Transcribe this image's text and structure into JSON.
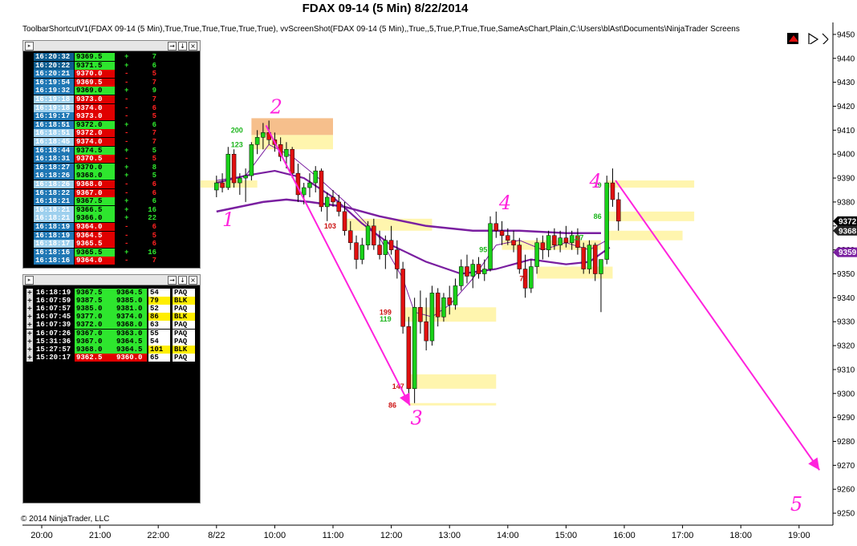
{
  "window": {
    "title": "FDAX 09-14 (5 Min)  8/22/2014",
    "indicator_line": "ToolbarShortcutV1(FDAX 09-14 (5 Min),True,True,True,True,True,True), vvScreenShot(FDAX 09-14 (5 Min),,True,,5,True,P,True,True,SameAsChart,Plain,C:\\Users\\blAst\\Documents\\NinjaTrader Screens",
    "copyright": "© 2014 NinjaTrader, LLC"
  },
  "colors": {
    "up_candle": "#19d119",
    "down_candle": "#e01010",
    "ma_color": "#7a1fa0",
    "zone_yellow": "#fff3a0",
    "zone_orange": "#f5b478",
    "annotation_magenta": "#ff22dd",
    "buy_green": "#33ff33",
    "sell_red": "#ff2222"
  },
  "chart_data": {
    "type": "candlestick",
    "title": "FDAX 09-14 (5 Min)  8/22/2014",
    "ylim": [
      9245,
      9455
    ],
    "y_ticks": [
      9250,
      9260,
      9270,
      9280,
      9290,
      9300,
      9310,
      9320,
      9330,
      9340,
      9350,
      9360,
      9370,
      9380,
      9390,
      9400,
      9410,
      9420,
      9430,
      9440,
      9450
    ],
    "y_tick_labels": [
      "9250",
      "9260",
      "9270",
      "9280",
      "9290",
      "9300",
      "9310",
      "9320",
      "9330",
      "9340",
      "9350",
      "9360",
      "9370",
      "9380",
      "9390",
      "9400",
      "9410",
      "9420",
      "9430",
      "9440",
      "9450"
    ],
    "x_hours": [
      20,
      21,
      22,
      23,
      24,
      25,
      26,
      27,
      28,
      29,
      30,
      31,
      32,
      33
    ],
    "x_tick_labels": [
      "20:00",
      "21:00",
      "22:00",
      "8/22",
      "10:00",
      "11:00",
      "12:00",
      "13:00",
      "14:00",
      "15:00",
      "16:00",
      "17:00",
      "18:00",
      "19:00"
    ],
    "price_badges": [
      {
        "value": 9372,
        "label": "9372",
        "color": "#000000"
      },
      {
        "value": 9368,
        "label": "9368",
        "color": "#222222"
      },
      {
        "value": 9359,
        "label": "9359",
        "color": "#7a1fa0"
      }
    ],
    "candles": [
      [
        23.0,
        9385,
        9391,
        9382,
        9388
      ],
      [
        23.1,
        9388,
        9392,
        9384,
        9386
      ],
      [
        23.2,
        9386,
        9403,
        9385,
        9400
      ],
      [
        23.3,
        9400,
        9402,
        9386,
        9388
      ],
      [
        23.4,
        9388,
        9392,
        9383,
        9390
      ],
      [
        23.5,
        9390,
        9394,
        9380,
        9391
      ],
      [
        23.6,
        9391,
        9405,
        9389,
        9404
      ],
      [
        23.7,
        9404,
        9410,
        9400,
        9407
      ],
      [
        23.8,
        9407,
        9413,
        9402,
        9409
      ],
      [
        23.9,
        9409,
        9414,
        9404,
        9406
      ],
      [
        24.0,
        9406,
        9409,
        9401,
        9404
      ],
      [
        24.1,
        9404,
        9407,
        9397,
        9399
      ],
      [
        24.2,
        9399,
        9405,
        9394,
        9402
      ],
      [
        24.3,
        9402,
        9403,
        9390,
        9392
      ],
      [
        24.4,
        9392,
        9396,
        9380,
        9383
      ],
      [
        24.5,
        9383,
        9388,
        9379,
        9386
      ],
      [
        24.6,
        9386,
        9392,
        9382,
        9388
      ],
      [
        24.7,
        9388,
        9395,
        9384,
        9393
      ],
      [
        24.8,
        9393,
        9394,
        9376,
        9378
      ],
      [
        24.9,
        9378,
        9384,
        9372,
        9382
      ],
      [
        25.0,
        9382,
        9385,
        9378,
        9380
      ],
      [
        25.1,
        9380,
        9383,
        9374,
        9376
      ],
      [
        25.2,
        9376,
        9380,
        9366,
        9368
      ],
      [
        25.3,
        9368,
        9372,
        9360,
        9363
      ],
      [
        25.4,
        9363,
        9366,
        9352,
        9356
      ],
      [
        25.5,
        9356,
        9365,
        9354,
        9362
      ],
      [
        25.6,
        9362,
        9372,
        9360,
        9370
      ],
      [
        25.7,
        9370,
        9373,
        9360,
        9362
      ],
      [
        25.8,
        9362,
        9368,
        9356,
        9358
      ],
      [
        25.9,
        9358,
        9366,
        9352,
        9364
      ],
      [
        26.0,
        9364,
        9370,
        9358,
        9360
      ],
      [
        26.1,
        9360,
        9364,
        9348,
        9352
      ],
      [
        26.2,
        9352,
        9355,
        9325,
        9328
      ],
      [
        26.3,
        9328,
        9332,
        9296,
        9302
      ],
      [
        26.4,
        9302,
        9340,
        9296,
        9336
      ],
      [
        26.5,
        9336,
        9343,
        9325,
        9330
      ],
      [
        26.6,
        9330,
        9340,
        9318,
        9322
      ],
      [
        26.7,
        9322,
        9345,
        9320,
        9342
      ],
      [
        26.8,
        9342,
        9344,
        9328,
        9332
      ],
      [
        26.9,
        9332,
        9342,
        9330,
        9340
      ],
      [
        27.0,
        9340,
        9345,
        9333,
        9337
      ],
      [
        27.1,
        9337,
        9348,
        9335,
        9345
      ],
      [
        27.2,
        9345,
        9356,
        9343,
        9353
      ],
      [
        27.3,
        9353,
        9358,
        9346,
        9349
      ],
      [
        27.4,
        9349,
        9356,
        9344,
        9354
      ],
      [
        27.5,
        9354,
        9357,
        9348,
        9350
      ],
      [
        27.6,
        9350,
        9356,
        9347,
        9352
      ],
      [
        27.7,
        9352,
        9374,
        9351,
        9371
      ],
      [
        27.8,
        9371,
        9376,
        9365,
        9368
      ],
      [
        27.9,
        9368,
        9372,
        9362,
        9366
      ],
      [
        28.0,
        9366,
        9369,
        9362,
        9364
      ],
      [
        28.1,
        9364,
        9368,
        9359,
        9362
      ],
      [
        28.2,
        9362,
        9365,
        9350,
        9352
      ],
      [
        28.3,
        9352,
        9358,
        9340,
        9344
      ],
      [
        28.4,
        9344,
        9356,
        9342,
        9353
      ],
      [
        28.5,
        9353,
        9365,
        9350,
        9363
      ],
      [
        28.6,
        9363,
        9366,
        9356,
        9360
      ],
      [
        28.7,
        9360,
        9368,
        9357,
        9366
      ],
      [
        28.8,
        9366,
        9369,
        9360,
        9362
      ],
      [
        28.9,
        9362,
        9368,
        9359,
        9365
      ],
      [
        29.0,
        9365,
        9370,
        9361,
        9363
      ],
      [
        29.1,
        9363,
        9368,
        9360,
        9366
      ],
      [
        29.2,
        9366,
        9369,
        9358,
        9361
      ],
      [
        29.3,
        9361,
        9363,
        9350,
        9352
      ],
      [
        29.4,
        9352,
        9364,
        9350,
        9362
      ],
      [
        29.5,
        9362,
        9363,
        9347,
        9350
      ],
      [
        29.6,
        9350,
        9354,
        9334,
        9356
      ],
      [
        29.7,
        9356,
        9391,
        9354,
        9388
      ],
      [
        29.8,
        9388,
        9394,
        9378,
        9381
      ],
      [
        29.9,
        9381,
        9384,
        9368,
        9372
      ]
    ],
    "ma_fast": [
      [
        23.0,
        9389
      ],
      [
        23.5,
        9391
      ],
      [
        23.9,
        9404
      ],
      [
        24.3,
        9399
      ],
      [
        24.8,
        9389
      ],
      [
        25.3,
        9378
      ],
      [
        25.8,
        9365
      ],
      [
        26.2,
        9348
      ],
      [
        26.4,
        9334
      ],
      [
        26.7,
        9332
      ],
      [
        27.0,
        9337
      ],
      [
        27.4,
        9348
      ],
      [
        27.8,
        9362
      ],
      [
        28.2,
        9364
      ],
      [
        28.6,
        9360
      ],
      [
        29.0,
        9363
      ],
      [
        29.4,
        9360
      ],
      [
        29.7,
        9364
      ]
    ],
    "ma_slow": [
      [
        23.0,
        9376
      ],
      [
        23.4,
        9378
      ],
      [
        23.8,
        9380
      ],
      [
        24.2,
        9381
      ],
      [
        24.6,
        9380
      ],
      [
        25.2,
        9378
      ],
      [
        25.8,
        9374
      ],
      [
        26.6,
        9370
      ],
      [
        27.4,
        9368
      ],
      [
        28.2,
        9368
      ],
      [
        29.0,
        9367
      ],
      [
        29.6,
        9367
      ]
    ],
    "ma_third": [
      [
        23.0,
        9388
      ],
      [
        23.5,
        9391
      ],
      [
        24.0,
        9393
      ],
      [
        24.5,
        9390
      ],
      [
        25.0,
        9382
      ],
      [
        25.5,
        9371
      ],
      [
        26.0,
        9362
      ],
      [
        26.6,
        9355
      ],
      [
        27.2,
        9350
      ],
      [
        27.8,
        9352
      ],
      [
        28.4,
        9356
      ],
      [
        29.0,
        9354
      ],
      [
        29.4,
        9355
      ],
      [
        29.75,
        9361
      ]
    ],
    "zones": [
      {
        "x0": 23.6,
        "x1": 25.0,
        "y_low": 9402,
        "y_high": 9408,
        "color": "yellow"
      },
      {
        "x0": 23.6,
        "x1": 25.0,
        "y_low": 9408,
        "y_high": 9415,
        "color": "orange"
      },
      {
        "x0": 22.7,
        "x1": 23.7,
        "y_low": 9386,
        "y_high": 9389,
        "color": "yellow"
      },
      {
        "x0": 25.2,
        "x1": 26.7,
        "y_low": 9368,
        "y_high": 9373,
        "color": "yellow"
      },
      {
        "x0": 26.2,
        "x1": 27.0,
        "y_low": 9330,
        "y_high": 9336,
        "color": "yellow"
      },
      {
        "x0": 27.0,
        "x1": 27.8,
        "y_low": 9330,
        "y_high": 9336,
        "color": "yellow"
      },
      {
        "x0": 26.3,
        "x1": 27.8,
        "y_low": 9302,
        "y_high": 9308,
        "color": "yellow"
      },
      {
        "x0": 26.3,
        "x1": 27.8,
        "y_low": 9295,
        "y_high": 9296,
        "color": "yellow"
      },
      {
        "x0": 27.9,
        "x1": 29.6,
        "y_low": 9360,
        "y_high": 9364,
        "color": "yellow"
      },
      {
        "x0": 28.5,
        "x1": 29.8,
        "y_low": 9348,
        "y_high": 9353,
        "color": "yellow"
      },
      {
        "x0": 29.7,
        "x1": 31.2,
        "y_low": 9386,
        "y_high": 9389,
        "color": "yellow"
      },
      {
        "x0": 29.7,
        "x1": 31.2,
        "y_low": 9372,
        "y_high": 9376,
        "color": "yellow"
      },
      {
        "x0": 29.7,
        "x1": 31.0,
        "y_low": 9364,
        "y_high": 9368,
        "color": "yellow"
      }
    ],
    "volume_labels": [
      {
        "label": "200",
        "x": 23.35,
        "y": 9410,
        "color": "green"
      },
      {
        "label": "123",
        "x": 23.35,
        "y": 9404,
        "color": "green"
      },
      {
        "label": "103",
        "x": 24.95,
        "y": 9370,
        "color": "red"
      },
      {
        "label": "95",
        "x": 27.58,
        "y": 9360,
        "color": "green"
      },
      {
        "label": "199",
        "x": 25.9,
        "y": 9334,
        "color": "red"
      },
      {
        "label": "119",
        "x": 25.9,
        "y": 9331,
        "color": "green"
      },
      {
        "label": "147",
        "x": 26.12,
        "y": 9303,
        "color": "red"
      },
      {
        "label": "86",
        "x": 26.02,
        "y": 9295,
        "color": "red"
      },
      {
        "label": "76",
        "x": 28.27,
        "y": 9348,
        "color": "red"
      },
      {
        "label": "79",
        "x": 29.54,
        "y": 9387,
        "color": "green"
      },
      {
        "label": "86",
        "x": 29.54,
        "y": 9374,
        "color": "green"
      },
      {
        "label": "127",
        "x": 29.2,
        "y": 9365,
        "color": "green"
      }
    ],
    "annotations": [
      {
        "text": "1",
        "x": 23.1,
        "y": 9370
      },
      {
        "text": "2",
        "x": 23.92,
        "y": 9417
      },
      {
        "text": "3",
        "x": 26.33,
        "y": 9287
      },
      {
        "text": "4",
        "x": 27.85,
        "y": 9377
      },
      {
        "text": "4",
        "x": 29.4,
        "y": 9386
      },
      {
        "text": "5",
        "x": 32.85,
        "y": 9251
      }
    ],
    "arrows": [
      {
        "x0": 23.85,
        "y0": 9412,
        "x1": 26.32,
        "y1": 9295
      },
      {
        "x0": 29.85,
        "y0": 9389,
        "x1": 33.35,
        "y1": 9268
      }
    ]
  },
  "time_sales": {
    "rows": [
      {
        "time": "16:20:32",
        "price": "9369.5",
        "side": "+",
        "size": "7"
      },
      {
        "time": "16:20:22",
        "price": "9371.5",
        "side": "+",
        "size": "6"
      },
      {
        "time": "16:20:21",
        "price": "9370.0",
        "side": "-",
        "size": "5"
      },
      {
        "time": "16:19:54",
        "price": "9369.5",
        "side": "-",
        "size": "7"
      },
      {
        "time": "16:19:32",
        "price": "9369.0",
        "side": "+",
        "size": "9"
      },
      {
        "time": "16:19:18",
        "price": "9373.0",
        "side": "-",
        "size": "7"
      },
      {
        "time": "16:19:18",
        "price": "9374.0",
        "side": "-",
        "size": "6"
      },
      {
        "time": "16:19:17",
        "price": "9373.0",
        "side": "-",
        "size": "5"
      },
      {
        "time": "16:18:51",
        "price": "9372.0",
        "side": "+",
        "size": "6"
      },
      {
        "time": "16:18:51",
        "price": "9372.0",
        "side": "-",
        "size": "7"
      },
      {
        "time": "16:18:45",
        "price": "9374.0",
        "side": "-",
        "size": "7"
      },
      {
        "time": "16:18:44",
        "price": "9374.5",
        "side": "+",
        "size": "5"
      },
      {
        "time": "16:18:31",
        "price": "9370.5",
        "side": "-",
        "size": "5"
      },
      {
        "time": "16:18:27",
        "price": "9370.0",
        "side": "+",
        "size": "8"
      },
      {
        "time": "16:18:26",
        "price": "9368.0",
        "side": "+",
        "size": "5"
      },
      {
        "time": "16:18:26",
        "price": "9368.0",
        "side": "-",
        "size": "6"
      },
      {
        "time": "16:18:22",
        "price": "9367.0",
        "side": "-",
        "size": "6"
      },
      {
        "time": "16:18:21",
        "price": "9367.5",
        "side": "+",
        "size": "6"
      },
      {
        "time": "16:18:21",
        "price": "9366.5",
        "side": "+",
        "size": "16"
      },
      {
        "time": "16:18:21",
        "price": "9366.0",
        "side": "+",
        "size": "22"
      },
      {
        "time": "16:18:19",
        "price": "9364.0",
        "side": "-",
        "size": "6"
      },
      {
        "time": "16:18:19",
        "price": "9364.5",
        "side": "-",
        "size": "5"
      },
      {
        "time": "16:18:17",
        "price": "9365.5",
        "side": "-",
        "size": "6"
      },
      {
        "time": "16:18:16",
        "price": "9365.5",
        "side": "+",
        "size": "16"
      },
      {
        "time": "16:18:16",
        "price": "9364.0",
        "side": "-",
        "size": "7"
      }
    ]
  },
  "blocks": {
    "rows": [
      {
        "time": "16:18:19",
        "high": "9367.5",
        "low": "9364.5",
        "size": "54",
        "tag": "PAQ"
      },
      {
        "time": "16:07:59",
        "high": "9387.5",
        "low": "9385.0",
        "size": "79",
        "tag": "BLK"
      },
      {
        "time": "16:07:57",
        "high": "9385.0",
        "low": "9381.0",
        "size": "52",
        "tag": "PAQ"
      },
      {
        "time": "16:07:45",
        "high": "9377.0",
        "low": "9374.0",
        "size": "86",
        "tag": "BLK"
      },
      {
        "time": "16:07:39",
        "high": "9372.0",
        "low": "9368.0",
        "size": "63",
        "tag": "PAQ"
      },
      {
        "time": "16:07:26",
        "high": "9367.0",
        "low": "9363.0",
        "size": "55",
        "tag": "PAQ"
      },
      {
        "time": "15:31:36",
        "high": "9367.0",
        "low": "9364.5",
        "size": "54",
        "tag": "PAQ"
      },
      {
        "time": "15:27:57",
        "high": "9368.0",
        "low": "9364.5",
        "size": "101",
        "tag": "BLK"
      },
      {
        "time": "15:20:17",
        "high": "9362.5",
        "low": "9360.0",
        "size": "65",
        "tag": "PAQ"
      }
    ]
  }
}
